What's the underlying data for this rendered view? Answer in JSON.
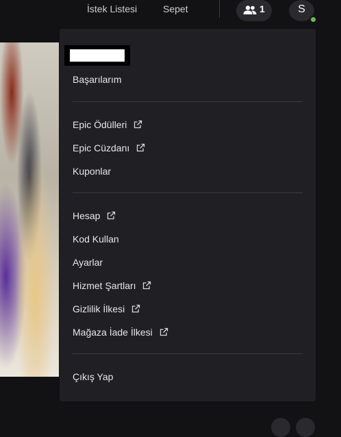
{
  "header": {
    "wishlist_label": "İstek Listesi",
    "cart_label": "Sepet",
    "friends_count": "1",
    "avatar_initial": "S"
  },
  "menu": {
    "achievements": "Başarılarım",
    "epic_rewards": "Epic Ödülleri",
    "epic_wallet": "Epic Cüzdanı",
    "coupons": "Kuponlar",
    "account": "Hesap",
    "redeem_code": "Kod Kullan",
    "settings": "Ayarlar",
    "terms_of_service": "Hizmet Şartları",
    "privacy_policy": "Gizlilik İlkesi",
    "store_refund_policy": "Mağaza İade İlkesi",
    "sign_out": "Çıkış Yap"
  },
  "icons": {
    "friends": "people-icon",
    "external": "external-link-icon"
  },
  "colors": {
    "background": "#121214",
    "menu_background": "#202024",
    "online_status": "#6dbb4d"
  }
}
